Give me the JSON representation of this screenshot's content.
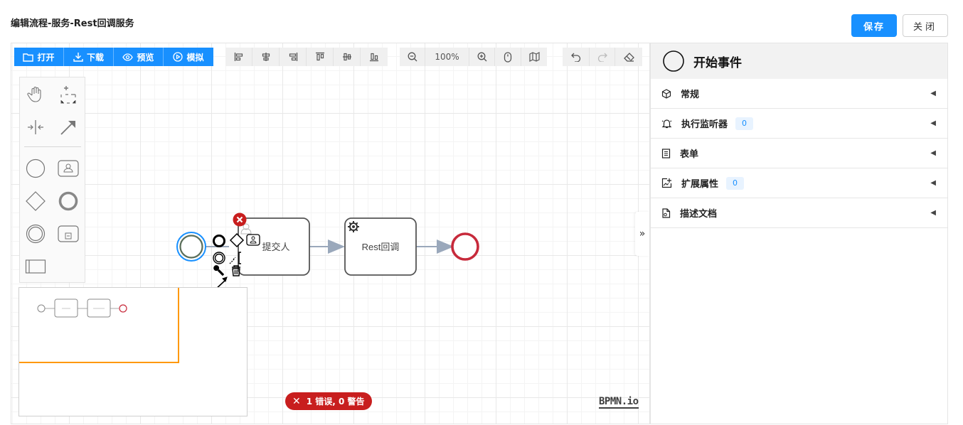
{
  "header": {
    "title": "编辑流程-服务-Rest回调服务",
    "save_label": "保存",
    "close_label": "关闭"
  },
  "toolbar": {
    "file_actions": [
      {
        "label": "打开",
        "icon": "folder-icon"
      },
      {
        "label": "下载",
        "icon": "download-icon"
      },
      {
        "label": "预览",
        "icon": "eye-icon"
      },
      {
        "label": "模拟",
        "icon": "play-circle-icon"
      }
    ],
    "align_actions": [
      "align-left-icon",
      "align-center-icon",
      "align-right-icon",
      "align-top-icon",
      "align-middle-icon",
      "align-bottom-icon"
    ],
    "zoom": {
      "level": "100%"
    },
    "history_actions": [
      "undo-icon",
      "redo-icon",
      "eraser-icon"
    ]
  },
  "diagram": {
    "task_user_label": "提交人",
    "task_service_label": "Rest回调",
    "colors": {
      "selected": "#1890ff",
      "end_event": "#c72a3b",
      "flow": "#9aa8bb",
      "error": "#c81e1e"
    }
  },
  "validation": {
    "summary": "1 错误, 0 警告"
  },
  "brand": {
    "logo": "BPMN.io"
  },
  "properties_panel": {
    "element_title": "开始事件",
    "groups": [
      {
        "label": "常规",
        "icon": "cube-icon",
        "badge": null
      },
      {
        "label": "执行监听器",
        "icon": "bell-icon",
        "badge": "0"
      },
      {
        "label": "表单",
        "icon": "form-icon",
        "badge": null
      },
      {
        "label": "扩展属性",
        "icon": "extension-icon",
        "badge": "0"
      },
      {
        "label": "描述文档",
        "icon": "document-icon",
        "badge": null
      }
    ]
  }
}
